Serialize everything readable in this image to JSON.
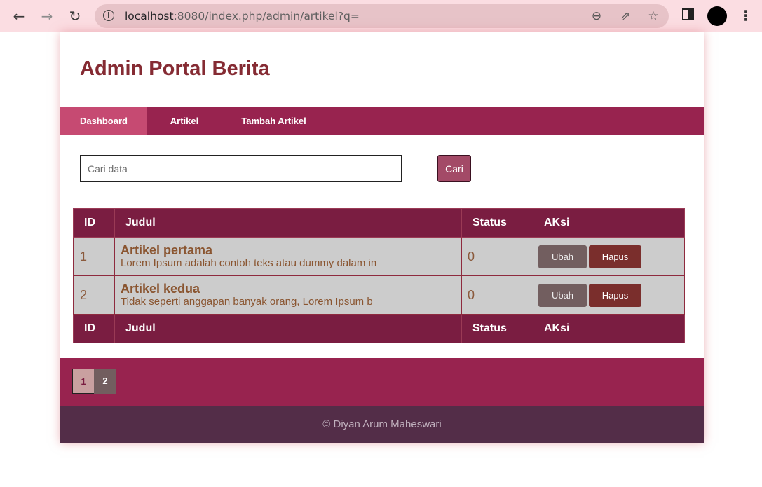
{
  "browser": {
    "url_host": "localhost",
    "url_rest": ":8080/index.php/admin/artikel?q="
  },
  "page": {
    "title": "Admin Portal Berita"
  },
  "nav": {
    "items": [
      "Dashboard",
      "Artikel",
      "Tambah Artikel"
    ],
    "active": "Dashboard"
  },
  "search": {
    "placeholder": "Cari data",
    "value": "",
    "button_label": "Cari"
  },
  "table": {
    "headers": [
      "ID",
      "Judul",
      "Status",
      "AKsi"
    ],
    "rows": [
      {
        "id": "1",
        "judul": "Artikel pertama",
        "snippet": "Lorem Ipsum adalah contoh teks atau dummy dalam in",
        "status": "0",
        "edit_label": "Ubah",
        "delete_label": "Hapus"
      },
      {
        "id": "2",
        "judul": "Artikel kedua",
        "snippet": "Tidak seperti anggapan banyak orang, Lorem Ipsum b",
        "status": "0",
        "edit_label": "Ubah",
        "delete_label": "Hapus"
      }
    ]
  },
  "pagination": {
    "pages": [
      "1",
      "2"
    ],
    "current": "1"
  },
  "footer": {
    "text": "© Diyan Arum Maheswari"
  },
  "colors": {
    "brand": "#98234f",
    "table_header": "#7a1d41",
    "title": "#852b33",
    "footer": "#532d48"
  }
}
